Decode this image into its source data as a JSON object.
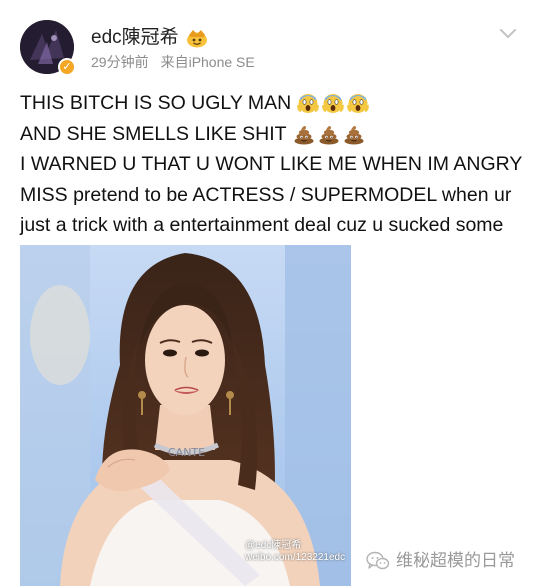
{
  "header": {
    "username": "edc陳冠希",
    "time": "29分钟前",
    "source": "来自iPhone SE",
    "avatar_icon": "avatar-image",
    "verified_icon": "verified-badge-icon",
    "vip_icon": "crown-emoji-icon",
    "menu_icon": "chevron-down-icon"
  },
  "post": {
    "lines": [
      {
        "text": "THIS BITCH IS SO UGLY MAN",
        "emoji": "screaming-face-icon",
        "emoji_count": 3
      },
      {
        "text": "AND SHE SMELLS LIKE SHIT",
        "emoji": "pile-of-poo-icon",
        "emoji_count": 3
      },
      {
        "text": "I WARNED U THAT U WONT LIKE ME WHEN IM ANGRY"
      },
      {
        "text": "MISS pretend to be ACTRESS / SUPERMODEL when ur"
      },
      {
        "text": "just a trick with a entertainment deal cuz u sucked some"
      }
    ]
  },
  "photo": {
    "watermark_line1": "@edc陳冠希",
    "watermark_line2": "weibo.com/123221edc",
    "sash_text": "CANTE"
  },
  "footer": {
    "account_name": "维秘超模的日常",
    "icon": "wechat-icon"
  },
  "colors": {
    "text": "#111111",
    "meta": "#8c8c8c",
    "verified": "#f5a623",
    "photo_background": "#a9c6ee",
    "footer_text": "#9a9a9a"
  }
}
